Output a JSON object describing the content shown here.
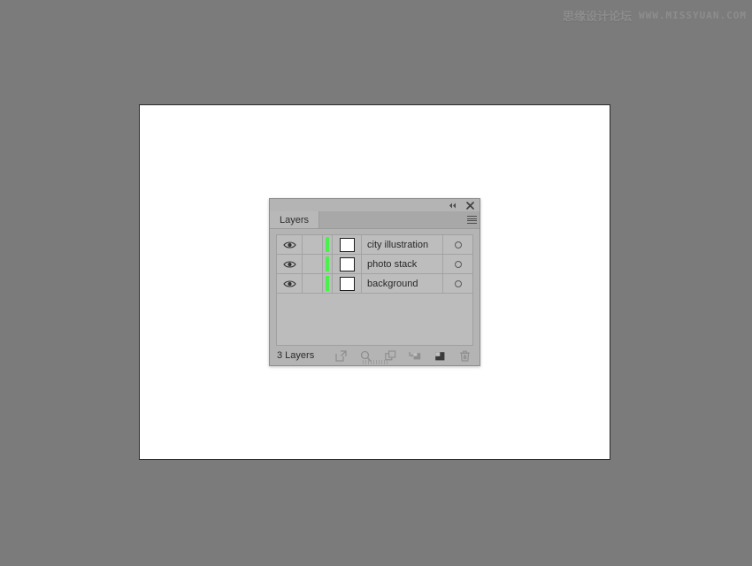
{
  "watermark": {
    "cn_text": "思缘设计论坛",
    "url_text": "WWW.MISSYUAN.COM"
  },
  "panel": {
    "titlebar": {
      "collapse_label": "◂◂",
      "close_label": "✕",
      "collapse_icon": "double-chevron-left-icon",
      "close_icon": "close-icon"
    },
    "tab": {
      "label": "Layers"
    },
    "menu": {
      "icon": "hamburger-menu-icon"
    },
    "rows": [
      {
        "name": "city illustration",
        "visible": true,
        "locked": false,
        "color": "#4cf04c",
        "thumb": "#ffffff",
        "target": "○"
      },
      {
        "name": "photo stack",
        "visible": true,
        "locked": false,
        "color": "#4cf04c",
        "thumb": "#ffffff",
        "target": "○"
      },
      {
        "name": "background",
        "visible": true,
        "locked": false,
        "color": "#4cf04c",
        "thumb": "#ffffff",
        "target": "○"
      }
    ],
    "footer": {
      "count_label": "3 Layers",
      "buttons": [
        {
          "icon": "release-to-layers-icon",
          "label": "Release to Layers"
        },
        {
          "icon": "locate-object-icon",
          "label": "Locate Object"
        },
        {
          "icon": "make-clipping-mask-icon",
          "label": "Make/Release Clipping Mask"
        },
        {
          "icon": "create-new-sublayer-icon",
          "label": "Create New Sublayer"
        },
        {
          "icon": "create-new-layer-icon",
          "label": "Create New Layer"
        },
        {
          "icon": "delete-selection-icon",
          "label": "Delete Selection"
        }
      ]
    }
  },
  "colors": {
    "desktop_background": "#7b7b7b",
    "artboard_background": "#ffffff",
    "panel_background": "#b4b4b4",
    "list_background": "#bcbcbc",
    "layer_color": "#4cf04c",
    "text": "#272727"
  }
}
